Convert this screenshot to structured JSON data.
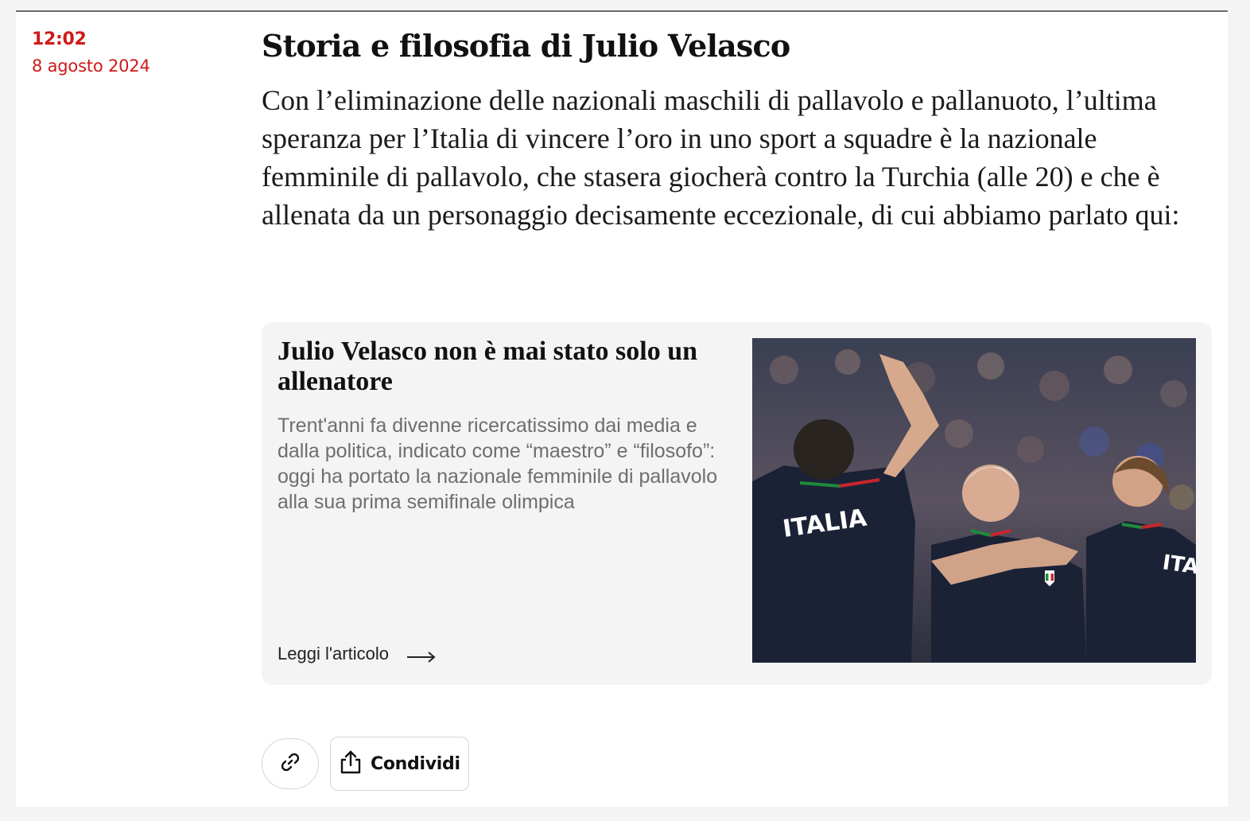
{
  "post": {
    "time": "12:02",
    "date": "8 agosto 2024",
    "title": "Storia e filosofia di Julio Velasco",
    "body": "Con l’eliminazione delle nazionali maschili di pallavolo e pallanuoto, l’ultima speranza per l’Italia di vincere l’oro in uno sport a squadre è la nazionale femminile di pallavolo, che stasera giocherà contro la Turchia (alle 20) e che è allenata da un personaggio decisamente eccezionale, di cui abbiamo parlato qui:"
  },
  "card": {
    "title": "Julio Velasco non è mai stato solo un allenatore",
    "description": "Trent'anni fa divenne ricercatissimo dai media e dalla politica, indicato come “maestro” e “filosofo”: oggi ha portato la nazionale femminile di pallavolo alla sua prima semifinale olimpica",
    "read_more": "Leggi l'articolo",
    "read_more_icon": "arrow-right-icon",
    "image": {
      "jersey_text_left": "ITALIA",
      "jersey_text_right": "ITALIA"
    }
  },
  "actions": {
    "link_icon": "link-icon",
    "share_icon": "share-icon",
    "share_label": "Condividi"
  },
  "colors": {
    "accent": "#cf1a1a",
    "card_bg": "#f4f4f4",
    "jersey": "#1b2236"
  }
}
